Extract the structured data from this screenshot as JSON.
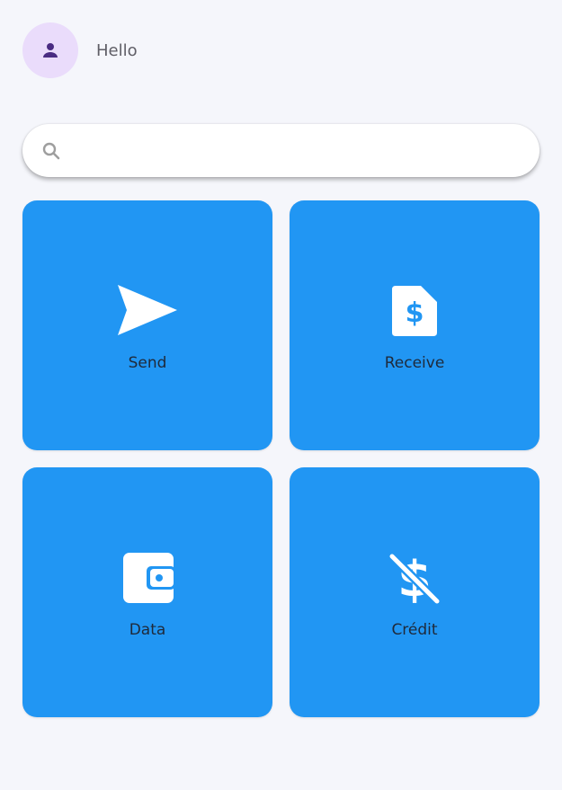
{
  "header": {
    "greeting": "Hello",
    "avatar_icon": "person-icon"
  },
  "search": {
    "placeholder": "",
    "value": "",
    "icon": "search-icon"
  },
  "tiles": [
    {
      "label": "Send",
      "icon": "send-icon"
    },
    {
      "label": "Receive",
      "icon": "receipt-dollar-icon"
    },
    {
      "label": "Data",
      "icon": "wallet-icon"
    },
    {
      "label": "Crédit",
      "icon": "money-off-icon"
    }
  ],
  "colors": {
    "background": "#f5f6fb",
    "tile": "#2196f3",
    "avatar_bg": "#eadcfb",
    "avatar_icon": "#4a2c82",
    "tile_icon": "#ffffff",
    "label_text": "#1f2a3a"
  }
}
